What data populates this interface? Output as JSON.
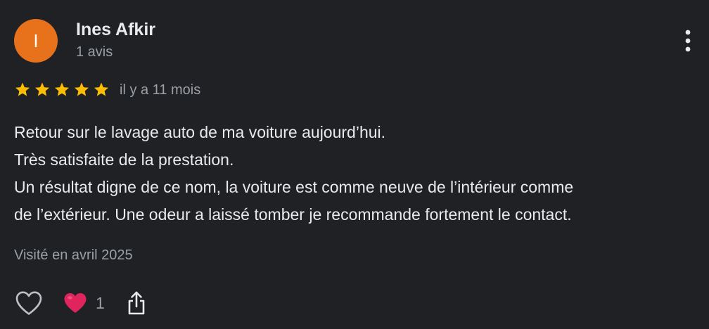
{
  "review": {
    "avatar_initial": "I",
    "author_name": "Ines Afkir",
    "review_count": "1 avis",
    "rating": 5,
    "rating_max": 5,
    "relative_date": "il y a 11 mois",
    "text_lines": [
      "Retour sur le lavage auto de ma voiture aujourd’hui.",
      "Très satisfaite de la prestation.",
      "Un résultat digne de ce nom, la voiture est comme neuve de l’intérieur comme",
      "de l’extérieur. Une odeur a laissé tomber je recommande fortement le contact."
    ],
    "visited": "Visité en avril 2025",
    "reaction_count": "1"
  },
  "icons": {
    "more": "more-vert-icon",
    "star": "star-icon",
    "like": "heart-outline-icon",
    "reaction": "red-heart-emoji-icon",
    "share": "share-icon"
  },
  "colors": {
    "background": "#202124",
    "avatar": "#E8711C",
    "star": "#FBBC04",
    "primary_text": "#e8eaed",
    "secondary_text": "#9aa0a6",
    "reaction_heart": "#E0245E"
  }
}
